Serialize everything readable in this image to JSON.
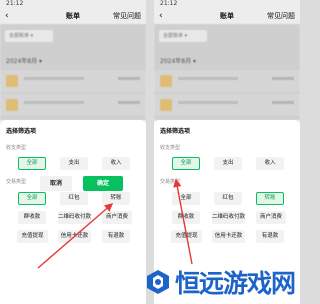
{
  "status_time": "21:12",
  "header": {
    "title": "账单",
    "faq": "常见问题",
    "back_icon": "chevron-left-icon"
  },
  "toolbar": {
    "filter_chip": "全部账单 ▾"
  },
  "month": "2024年8月 ▾",
  "sheet": {
    "title": "选择筛选项",
    "income_label": "收支类型",
    "income_options": [
      "全部",
      "支出",
      "收入"
    ],
    "trade_label": "交易类型",
    "trade_options": [
      "全部",
      "红包",
      "转账",
      "群收款",
      "二维码收付款",
      "商户消费",
      "充值提现",
      "信用卡还款",
      "有退款"
    ],
    "cancel": "取消",
    "confirm": "确定"
  },
  "left_panel": {
    "selected_trade": "全部"
  },
  "right_panel": {
    "selected_trade": "转账"
  },
  "watermark": {
    "text": "恒远游戏网"
  },
  "colors": {
    "accent": "#07c160",
    "arrow": "#e53935",
    "watermark": "#1e63c9"
  }
}
